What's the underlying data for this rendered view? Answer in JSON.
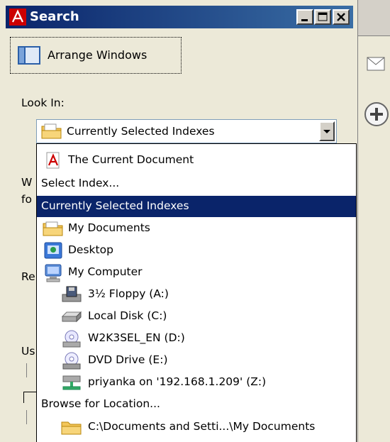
{
  "window": {
    "title": "Search"
  },
  "arrange": {
    "label": "Arrange Windows"
  },
  "look_in": {
    "label": "Look In:",
    "selected": "Currently Selected Indexes",
    "options": [
      {
        "label": "The Current Document",
        "icon": "pdf-document-icon"
      },
      {
        "label": "Select Index..."
      },
      {
        "label": "Currently Selected Indexes"
      },
      {
        "label": "My Documents",
        "icon": "folder-documents-icon"
      },
      {
        "label": "Desktop",
        "icon": "desktop-icon"
      },
      {
        "label": "My Computer",
        "icon": "computer-icon"
      },
      {
        "label": "3½ Floppy (A:)",
        "icon": "floppy-drive-icon"
      },
      {
        "label": "Local Disk (C:)",
        "icon": "hard-disk-icon"
      },
      {
        "label": "W2K3SEL_EN (D:)",
        "icon": "cd-drive-icon"
      },
      {
        "label": "DVD Drive (E:)",
        "icon": "dvd-drive-icon"
      },
      {
        "label": "priyanka on '192.168.1.209' (Z:)",
        "icon": "network-drive-icon"
      },
      {
        "label": "Browse for Location..."
      },
      {
        "label": "C:\\Documents and Setti...\\My Documents",
        "icon": "folder-icon"
      }
    ]
  },
  "partial_labels": [
    "W",
    "fo",
    "Re",
    "Us"
  ]
}
